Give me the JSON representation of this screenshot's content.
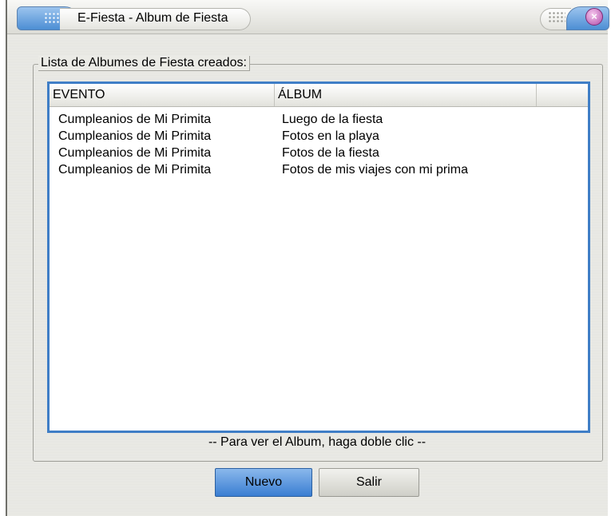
{
  "window": {
    "title": "E-Fiesta - Album de Fiesta"
  },
  "group": {
    "label": "Lista de Albumes de Fiesta creados:"
  },
  "list": {
    "columns": [
      "EVENTO",
      "ÁLBUM"
    ],
    "rows": [
      [
        "Cumpleanios de Mi Primita",
        "Luego de la fiesta"
      ],
      [
        "Cumpleanios de Mi Primita",
        "Fotos en la playa"
      ],
      [
        "Cumpleanios de Mi Primita",
        "Fotos de la fiesta"
      ],
      [
        "Cumpleanios de Mi Primita",
        "Fotos de mis viajes con mi prima"
      ]
    ]
  },
  "hint": "-- Para ver el Album, haga doble clic --",
  "buttons": {
    "new_label": "Nuevo",
    "exit_label": "Salir"
  },
  "colors": {
    "accent": "#3f7ec6",
    "window_bg": "#ebebe6",
    "close_button": "#b04aa8"
  },
  "icons": {
    "close": "close-icon"
  }
}
